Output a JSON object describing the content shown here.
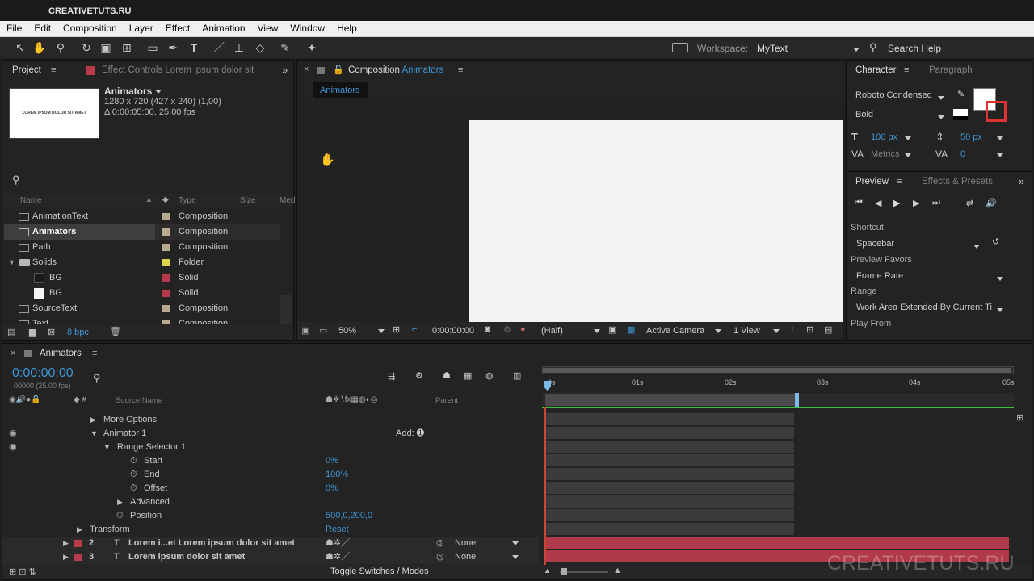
{
  "title_bar": "CREATIVETUTS.RU",
  "menu": [
    "File",
    "Edit",
    "Composition",
    "Layer",
    "Effect",
    "Animation",
    "View",
    "Window",
    "Help"
  ],
  "toolbar": {
    "workspace_label": "Workspace:",
    "workspace_value": "MyText",
    "search_help": "Search Help"
  },
  "project": {
    "tab": "Project",
    "effect_tab": "Effect Controls Lorem ipsum dolor sit",
    "thumb_text": "LOREM IPSUM DOLOR SIT AMET",
    "comp_name": "Animators",
    "comp_dims": "1280 x 720  (427 x 240) (1,00)",
    "comp_duration": "Δ 0:00:05:00, 25,00 fps",
    "col_name": "Name",
    "col_type": "Type",
    "col_size": "Size",
    "col_med": "Med",
    "bpc": "8 bpc",
    "items": [
      {
        "name": "AnimationText",
        "type": "Composition",
        "label_color": "#b9a98e"
      },
      {
        "name": "Animators",
        "type": "Composition",
        "label_color": "#b9a98e"
      },
      {
        "name": "Path",
        "type": "Composition",
        "label_color": "#b9a98e"
      },
      {
        "name": "Solids",
        "type": "Folder",
        "label_color": "#e0d44a"
      },
      {
        "name": "BG",
        "type": "Solid",
        "label_color": "#b83a4b"
      },
      {
        "name": "BG",
        "type": "Solid",
        "label_color": "#b83a4b"
      },
      {
        "name": "SourceText",
        "type": "Composition",
        "label_color": "#b9a98e"
      },
      {
        "name": "Text",
        "type": "Composition",
        "label_color": "#b9a98e"
      }
    ]
  },
  "composition": {
    "tab_label": "Composition",
    "tab_name": "Animators",
    "sub_tab": "Animators",
    "zoom": "50%",
    "timecode": "0:00:00:00",
    "resolution": "(Half)",
    "camera": "Active Camera",
    "view": "1 View"
  },
  "character": {
    "tab": "Character",
    "tab2": "Paragraph",
    "font": "Roboto Condensed",
    "style": "Bold",
    "size": "100 px",
    "leading": "50 px",
    "kerning": "Metrics",
    "tracking": "0"
  },
  "preview": {
    "tab": "Preview",
    "tab2": "Effects & Presets",
    "shortcut_label": "Shortcut",
    "shortcut_value": "Spacebar",
    "favors_label": "Preview Favors",
    "favors_value": "Frame Rate",
    "range_label": "Range",
    "range_value": "Work Area Extended By Current Ti",
    "play_from_label": "Play From"
  },
  "timeline": {
    "tab": "Animators",
    "timecode": "0:00:00:00",
    "frame_info": "00000 (25.00 fps)",
    "col_source": "Source Name",
    "col_parent": "Parent",
    "toggle_label": "Toggle Switches / Modes",
    "add_label": "Add:",
    "ruler": [
      "0s",
      "01s",
      "02s",
      "03s",
      "04s",
      "05s"
    ],
    "props": [
      {
        "label": "More Options",
        "value": ""
      },
      {
        "label": "Animator 1",
        "value": ""
      },
      {
        "label": "Range Selector 1",
        "value": ""
      },
      {
        "label": "Start",
        "value": "0%"
      },
      {
        "label": "End",
        "value": "100%"
      },
      {
        "label": "Offset",
        "value": "0%"
      },
      {
        "label": "Advanced",
        "value": ""
      },
      {
        "label": "Position",
        "value": "500,0,200,0"
      },
      {
        "label": "Transform",
        "value": "Reset"
      }
    ],
    "layers": [
      {
        "num": "2",
        "name": "Lorem i...et Lorem ipsum dolor sit amet",
        "parent": "None"
      },
      {
        "num": "3",
        "name": "Lorem ipsum dolor sit amet",
        "parent": "None"
      }
    ]
  },
  "watermark": "CREATIVETUTS.RU"
}
